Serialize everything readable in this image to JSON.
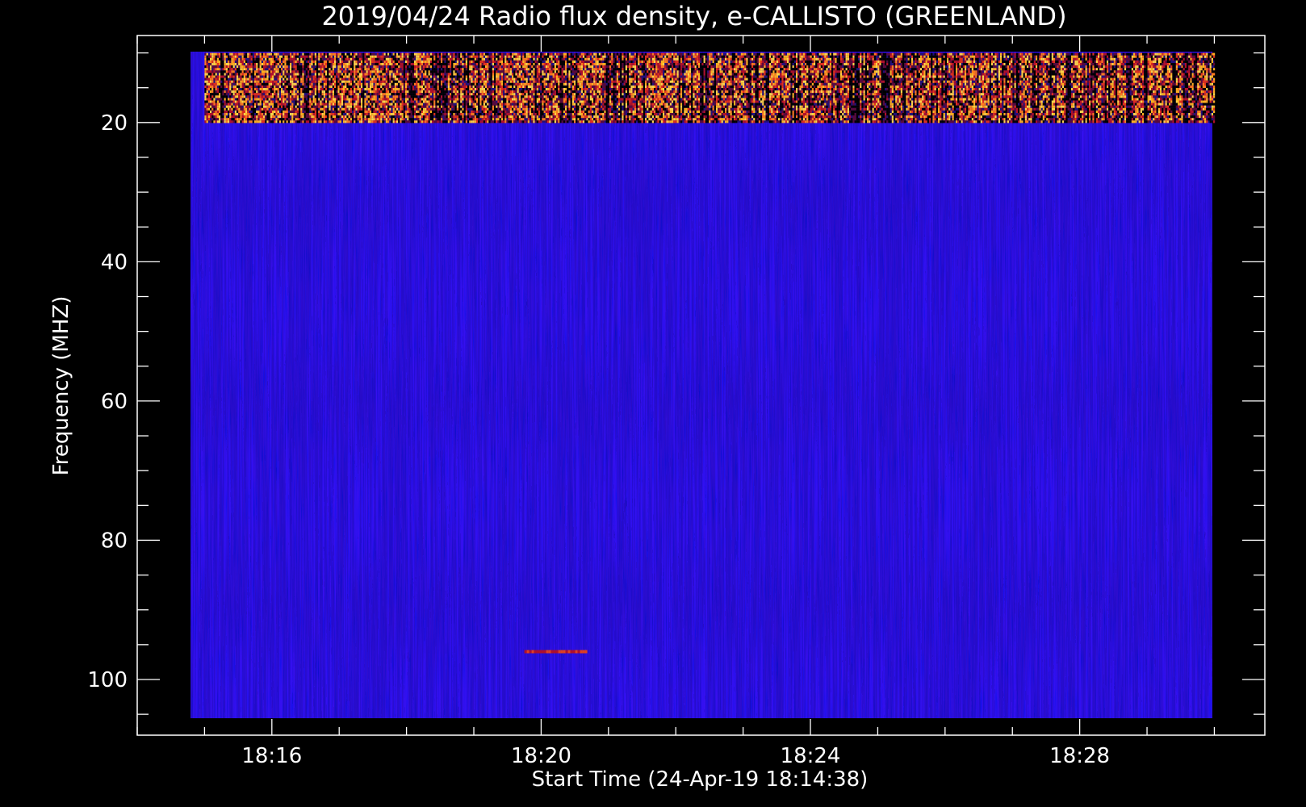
{
  "chart_data": {
    "type": "heatmap",
    "title": "2019/04/24  Radio flux density, e-CALLISTO (GREENLAND)",
    "xlabel": "Start Time (24-Apr-19 18:14:38)",
    "ylabel": "Frequency (MHZ)",
    "x_start": "18:15:00",
    "x_end": "18:30:00",
    "xlim": [
      "18:14:00",
      "18:30:45"
    ],
    "ylim": [
      108,
      7.5
    ],
    "x_ticks": [
      "18:16",
      "18:20",
      "18:24",
      "18:28"
    ],
    "x_minor_interval_minutes": 1,
    "y_ticks": [
      20,
      40,
      60,
      80,
      100
    ],
    "y_minor_interval": 5,
    "y_inverted": true,
    "frequency_range_mhz": [
      10,
      106
    ],
    "features": [
      {
        "description": "intense interference band",
        "frequency_mhz": [
          10,
          20
        ],
        "time": [
          "18:15",
          "18:30"
        ]
      },
      {
        "description": "short emission streak",
        "frequency_mhz": 96,
        "time": [
          "18:19:45",
          "18:20:40"
        ]
      }
    ],
    "colors": {
      "background": "#1a14ee",
      "low": "#000000",
      "mid": "#b0102a",
      "high": "#ffd24a",
      "frame": "#ffffff"
    },
    "grid": false
  }
}
